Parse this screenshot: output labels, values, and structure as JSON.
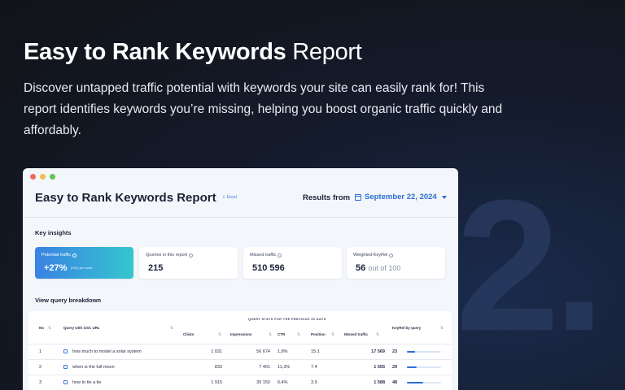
{
  "hero": {
    "title_bold": "Easy to Rank Keywords",
    "title_light": "Report",
    "description": "Discover untapped traffic potential with keywords your site can easily rank for! This report identifies keywords you’re missing, helping you boost organic traffic quickly and affordably.",
    "step_number": "2."
  },
  "window": {
    "dot_colors": [
      "#ee6a5f",
      "#f5bd4f",
      "#61c454"
    ],
    "title": "Easy to Rank Keywords Report",
    "excel_link": "⇩ Excel",
    "results_label": "Results from",
    "date": "September 22, 2024",
    "key_insights_label": "Key insights",
    "cards": {
      "potential": {
        "label": "Potential traffic",
        "value": "+27%",
        "sub": "(GSA) per month"
      },
      "queries": {
        "label": "Queries in this report",
        "value": "215"
      },
      "missed": {
        "label": "Missed traffic",
        "value": "510 596"
      },
      "keyrel": {
        "label": "Weighted KeyRel",
        "value": "56",
        "suffix": "out of 100"
      }
    },
    "breakdown_label": "View query breakdown",
    "table": {
      "span_header": "QUERY STATS FOR THE PREVIOUS 30 DAYS",
      "headers": {
        "no": "No",
        "query": "Query with GSC URL",
        "clicks": "Clicks",
        "impressions": "Impressions",
        "ctr": "CTR",
        "position": "Position",
        "missed": "Missed traffic",
        "keyrel": "KeyRel by query"
      },
      "rows": [
        {
          "no": "1",
          "query": "how much to model a solar system",
          "clicks": "1 031",
          "impressions": "56 674",
          "ctr": "1,8%",
          "position": "15.1",
          "missed": "17 569",
          "keyrel": "23",
          "keyrel_fraction": 0.23
        },
        {
          "no": "2",
          "query": "when is the full moon",
          "clicks": "833",
          "impressions": "7 401",
          "ctr": "11,3%",
          "position": "7.4",
          "missed": "1 555",
          "keyrel": "29",
          "keyrel_fraction": 0.29
        },
        {
          "no": "3",
          "query": "how to tie a tie",
          "clicks": "1 915",
          "impressions": "30 150",
          "ctr": "6,4%",
          "position": "3.9",
          "missed": "1 588",
          "keyrel": "48",
          "keyrel_fraction": 0.48
        }
      ]
    }
  }
}
